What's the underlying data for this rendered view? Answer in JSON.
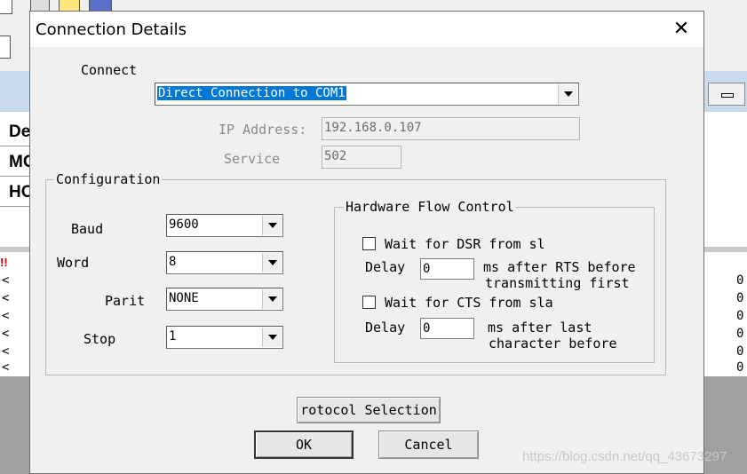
{
  "background": {
    "rows": [
      "De",
      "MO",
      "HO"
    ],
    "list_markers": [
      "<",
      "<",
      "<",
      "<",
      "<",
      "<"
    ],
    "list_values": [
      "0",
      "0",
      "0",
      "0",
      "0",
      "0"
    ],
    "error_marker": "!!"
  },
  "dialog": {
    "title": "Connection Details",
    "close_glyph": "✕",
    "connect_label": "Connect",
    "connect_value": "Direct Connection to COM1",
    "ip_label": "IP Address:",
    "ip_value": "192.168.0.107",
    "service_label": "Service",
    "service_value": "502",
    "configuration": {
      "title": "Configuration",
      "baud_label": "Baud",
      "baud_value": "9600",
      "word_label": "Word",
      "word_value": "8",
      "parity_label": "Parit",
      "parity_value": "NONE",
      "stop_label": "Stop",
      "stop_value": "1"
    },
    "flow": {
      "title": "Hardware Flow Control",
      "dsr_label": "Wait for DSR from sl",
      "dsr_checked": false,
      "delay1_label": "Delay",
      "delay1_value": "0",
      "delay1_desc_1": "ms after RTS before",
      "delay1_desc_2": "transmitting first",
      "cts_label": "Wait for CTS from sla",
      "cts_checked": false,
      "delay2_label": "Delay",
      "delay2_value": "0",
      "delay2_desc_1": "ms after last",
      "delay2_desc_2": "character before"
    },
    "protocol_button": "rotocol Selection",
    "ok_button": "OK",
    "cancel_button": "Cancel"
  },
  "watermark": "https://blog.csdn.net/qq_43673297",
  "colors": {
    "selection": "#0078d7",
    "dialog_bg": "#f0f0f0",
    "band": "#c9dcee"
  }
}
